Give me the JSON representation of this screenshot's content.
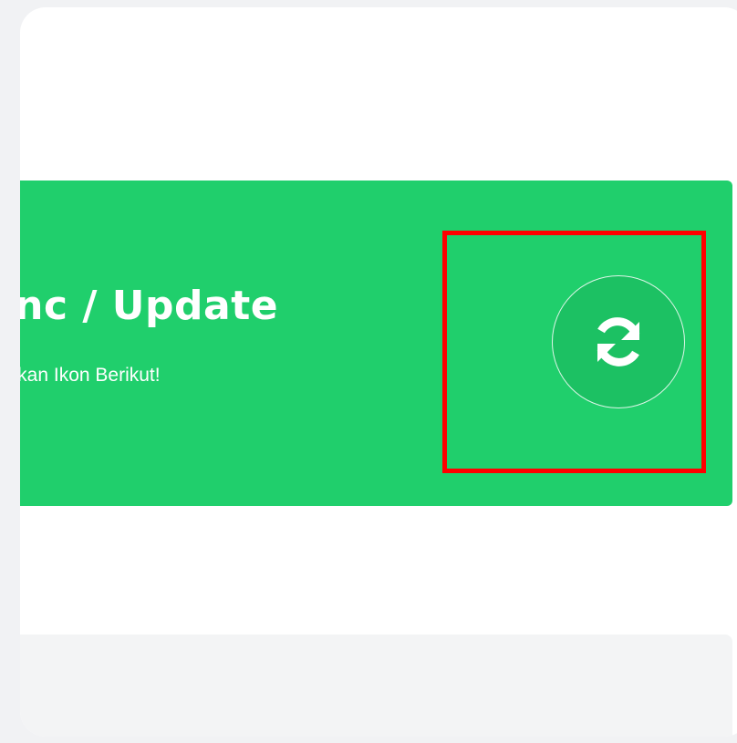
{
  "banner": {
    "title": "ync / Update",
    "subtitle": "hkan Tekan Ikon Berikut!",
    "background_color": "#20cf6c"
  },
  "sync_button": {
    "icon": "sync-icon"
  },
  "highlight": {
    "color": "#ff0000"
  }
}
